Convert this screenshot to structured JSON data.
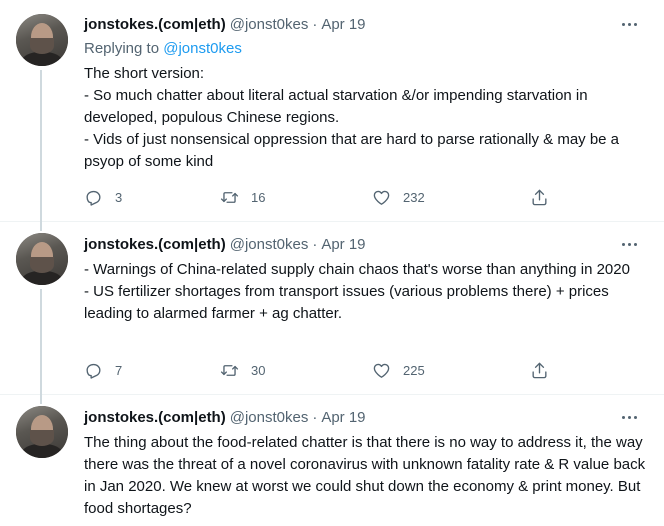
{
  "tweets": [
    {
      "author": {
        "name": "jonstokes.(com|eth)",
        "handle": "@jonst0kes"
      },
      "separator": "·",
      "date": "Apr 19",
      "replying_to": {
        "prefix": "Replying to ",
        "handle": "@jonst0kes"
      },
      "body": [
        "The short version:",
        "- So much chatter about literal actual starvation &/or impending starvation in developed, populous Chinese regions.",
        "- Vids of just nonsensical oppression that are hard to parse rationally & may be a psyop of some kind"
      ],
      "stats": {
        "replies": "3",
        "retweets": "16",
        "likes": "232"
      }
    },
    {
      "author": {
        "name": "jonstokes.(com|eth)",
        "handle": "@jonst0kes"
      },
      "separator": "·",
      "date": "Apr 19",
      "body": [
        "- Warnings of China-related supply chain chaos that's worse than anything in 2020",
        "- US fertilizer shortages from transport issues (various problems there) + prices leading to alarmed farmer + ag chatter."
      ],
      "stats": {
        "replies": "7",
        "retweets": "30",
        "likes": "225"
      }
    },
    {
      "author": {
        "name": "jonstokes.(com|eth)",
        "handle": "@jonst0kes"
      },
      "separator": "·",
      "date": "Apr 19",
      "body": [
        "The thing about the food-related chatter is that there is no way to address it, the way there was the threat of a novel coronavirus with unknown fatality rate & R value back in Jan 2020. We knew at worst we could shut down the economy & print money. But food shortages?"
      ]
    }
  ],
  "icons": {
    "reply": "reply-icon",
    "retweet": "retweet-icon",
    "like": "heart-icon",
    "share": "share-icon",
    "more": "more-icon"
  },
  "colors": {
    "text": "#0f1419",
    "secondary": "#536471",
    "link": "#1d9bf0",
    "thread_line": "#cfd9de",
    "divider": "#eff3f4"
  }
}
